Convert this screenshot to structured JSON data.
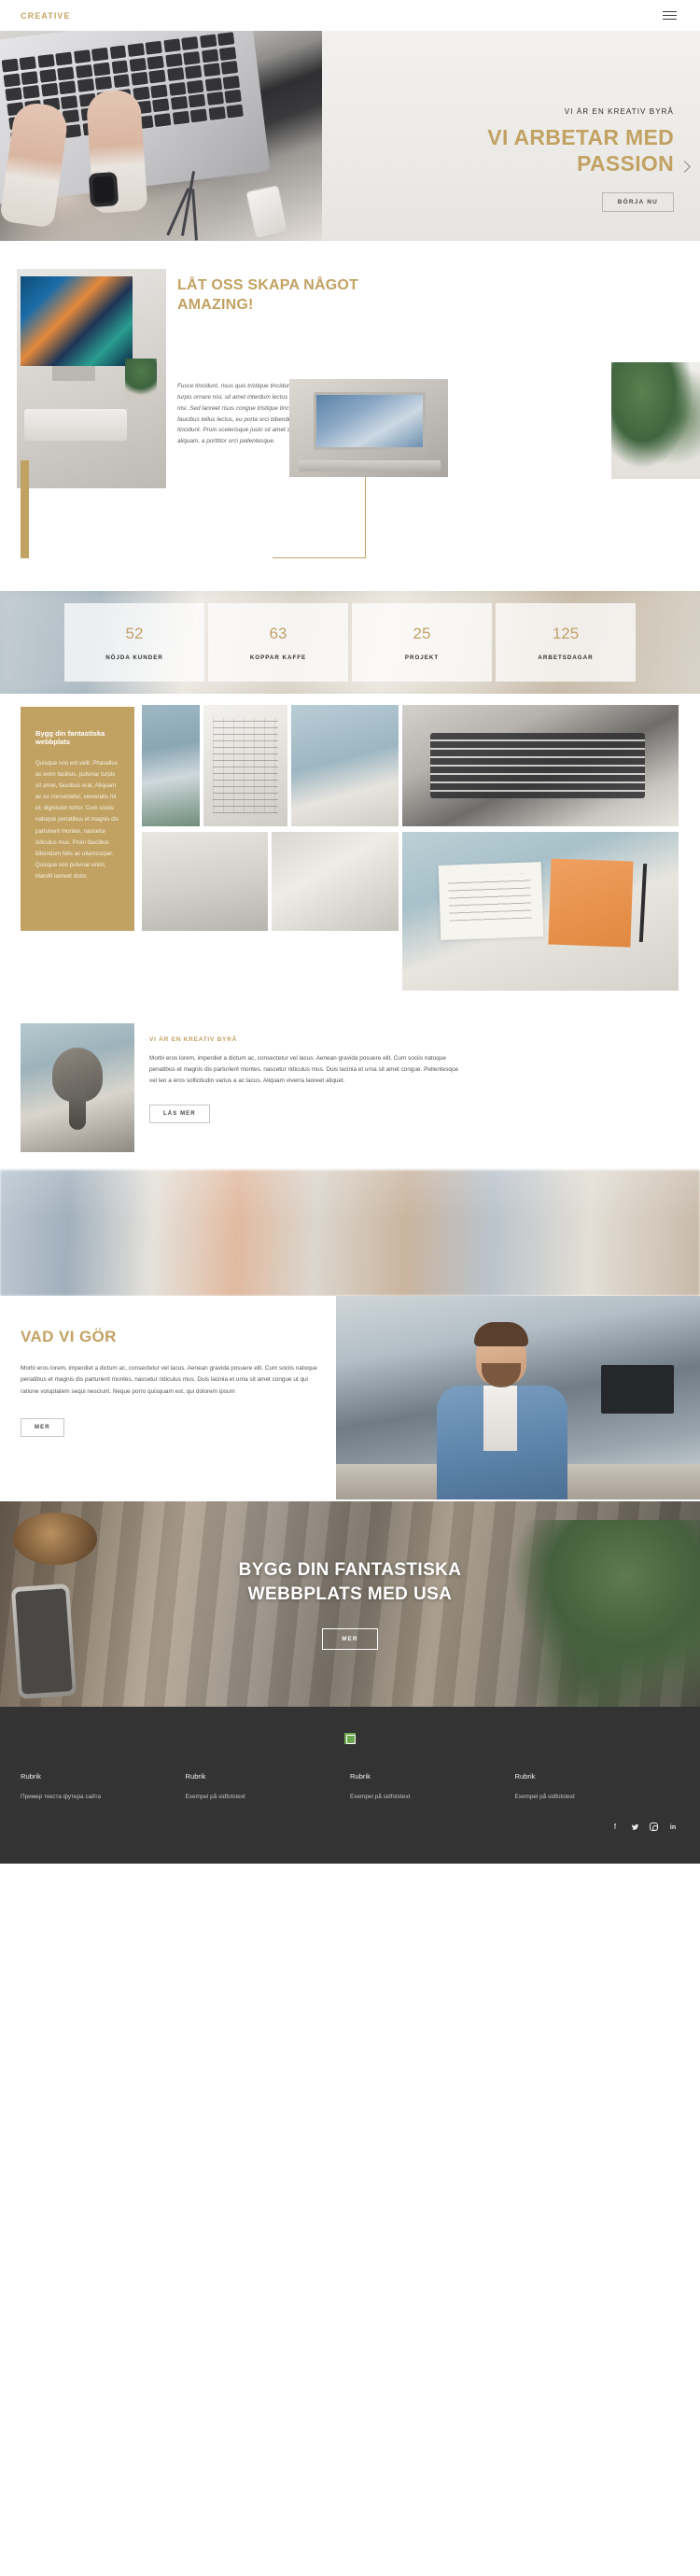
{
  "header": {
    "brand": "CREATIVE",
    "menu_icon": "hamburger-icon"
  },
  "hero": {
    "kicker": "VI ÄR EN KREATIV BYRÅ",
    "title_line1": "VI ARBETAR MED",
    "title_line2": "PASSION",
    "button": "BÖRJA NU",
    "next_arrow": "chevron-right-icon"
  },
  "create": {
    "heading_line1": "LÅT OSS SKAPA NÅGOT",
    "heading_line2": "AMAZING!",
    "body": "Fusce tincidunt, risus quis tristique tincidunt, diam turpis ornare nisi, sit amet interdum lectus ligula a nisi. Sed laoreet risus congue tristique tincidunt. Duis faucibus tellus lectus, eu porta orci bibendum tincidunt. Proin scelerisque justo sit amet sem aliquam, a porttitor orci pellentesque."
  },
  "stats": [
    {
      "number": "52",
      "label": "NÖJDA KUNDER"
    },
    {
      "number": "63",
      "label": "KOPPAR KAFFE"
    },
    {
      "number": "25",
      "label": "PROJEKT"
    },
    {
      "number": "125",
      "label": "ARBETSDAGAR"
    }
  ],
  "mosaic": {
    "card_title": "Bygg din fantastiska webbplats",
    "card_body": "Quisque non est velit. Phasellus ac enim facilisis, pulvinar turpis sit amet, faucibus erat. Aliquam ac ex consectetur, venenatis mi et, dignissim tortor. Cum sociis natoque penatibus et magnis dis parturient montes, nascetur ridiculus mus. Proin faucibus bibendum felis ac ullamcorper. Quisque non pulvinar enim, blandit laoreet dolor."
  },
  "byra": {
    "kicker": "VI ÄR EN KREATIV BYRÅ",
    "body": "Morbi eros lorem, imperdiet a dictum ac, consectetur vel lacus. Aenean gravida posuere elit. Cum sociis natoque penatibus et magnis dis parturient montes, nascetur ridiculus mus. Duis lacinia et urna sit amet congue. Pellentesque vel leo a eros sollicitudin varius a ac lacus. Aliquam viverra laoreet aliquet.",
    "button": "LÄS MER"
  },
  "vadvi": {
    "title": "VAD VI GÖR",
    "body": "Morbi eros lorem, imperdiet a dictum ac, consectetur vel lacus. Aenean gravida posuere elit. Cum sociis natoque penatibus et magnis dis parturient montes, nascetur ridiculus mus. Duis lacinia et urna sit amet congue ut qui ratione voluptatem sequi nesciunt. Neque porro quisquam est, qui dolorem ipsum",
    "button": "MER"
  },
  "cta": {
    "title_line1": "BYGG DIN FANTASTISKA",
    "title_line2": "WEBBPLATS MED USA",
    "button": "MER"
  },
  "footer": {
    "logo": "broken-image-icon",
    "columns": [
      {
        "title": "Rubrik",
        "text": "Пример текста футера сайта"
      },
      {
        "title": "Rubrik",
        "text": "Exempel på sidfotstext"
      },
      {
        "title": "Rubrik",
        "text": "Exempel på sidfotstext"
      },
      {
        "title": "Rubrik",
        "text": "Exempel på sidfotstext"
      }
    ],
    "socials": [
      {
        "name": "facebook-icon",
        "glyph": "f"
      },
      {
        "name": "twitter-icon",
        "glyph": "🐦"
      },
      {
        "name": "instagram-icon",
        "glyph": ""
      },
      {
        "name": "linkedin-icon",
        "glyph": "in"
      }
    ]
  },
  "colors": {
    "accent_gold": "#c2a263",
    "footer_bg": "#333333",
    "text_dark": "#2e2e2e"
  }
}
